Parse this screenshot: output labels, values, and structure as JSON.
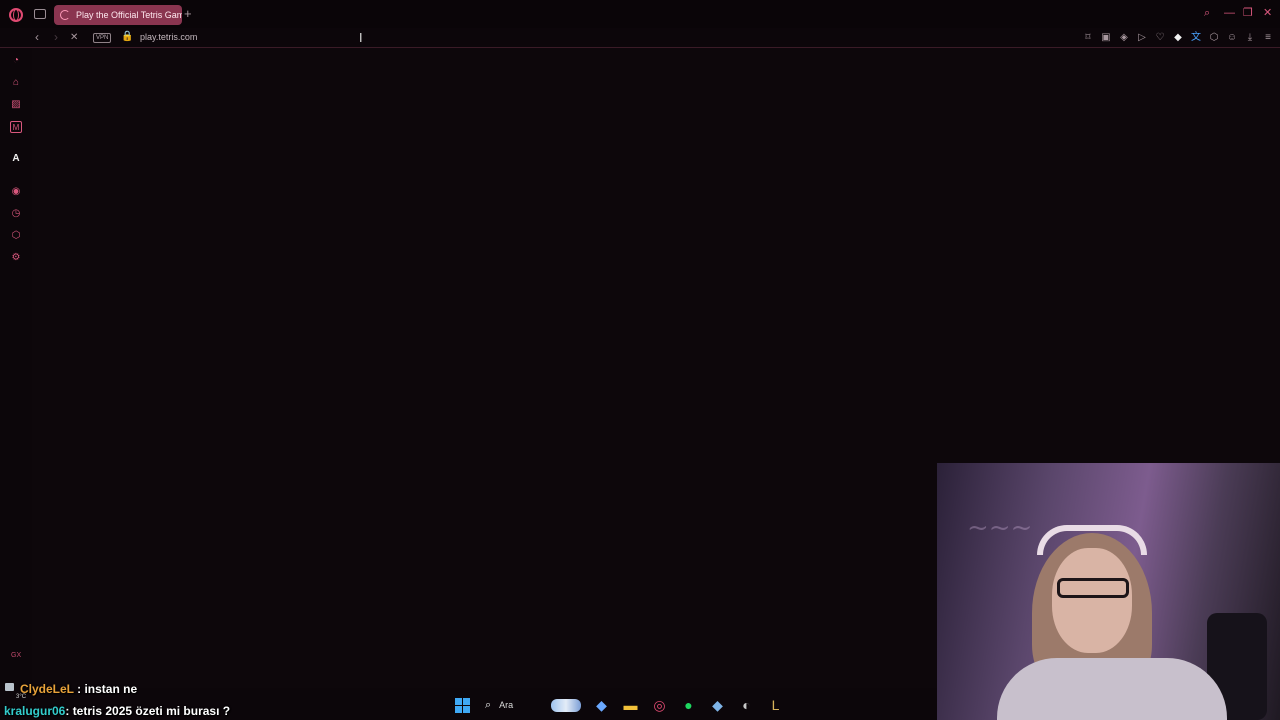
{
  "browser": {
    "tab_title": "Play the Official Tetris Game",
    "new_tab": "+",
    "url": "play.tetris.com",
    "vpn_badge": "VPN",
    "accent_color": "#e04a72"
  },
  "window_controls": {
    "search": "⌕",
    "minimize": "—",
    "maximize": "❐",
    "close": "✕"
  },
  "nav": {
    "back": "‹",
    "forward": "›",
    "stop": "✕"
  },
  "toolbar_icons": [
    "bookmark-icon",
    "snapshot-icon",
    "shield-icon",
    "play-icon",
    "heart-icon",
    "ext-diamond-icon",
    "ext-translate-icon",
    "extensions-icon",
    "account-icon",
    "download-icon",
    "menu-icon"
  ],
  "toolbar_glyphs": {
    "bookmark": "⌑",
    "snapshot": "▣",
    "shield": "◈",
    "play": "▷",
    "heart": "♡",
    "diamond": "◆",
    "translate": "文",
    "extensions": "⬡",
    "account": "☺",
    "download": "⤓",
    "menu": "≡"
  },
  "sidebar": {
    "items": [
      {
        "name": "gx-control-icon",
        "glyph": "◔"
      },
      {
        "name": "gx-corner-icon",
        "glyph": "⌂"
      },
      {
        "name": "gx-store-icon",
        "glyph": "▨"
      },
      {
        "name": "messenger-icon",
        "glyph": "M"
      },
      {
        "name": "aria-icon",
        "glyph": "A"
      },
      {
        "name": "player-icon",
        "glyph": "◉"
      },
      {
        "name": "history-icon",
        "glyph": "◷"
      },
      {
        "name": "extensions-icon",
        "glyph": "⬡"
      },
      {
        "name": "settings-icon",
        "glyph": "⚙"
      }
    ],
    "footer": "GX"
  },
  "chat": [
    {
      "user": "ClydeLeL",
      "message": " : instan ne"
    },
    {
      "user": "kralugur06",
      "message": ": tetris 2025 özeti mi burası ?"
    }
  ],
  "weather": "3°C",
  "taskbar": {
    "search_label": "Ara",
    "apps": [
      "start-icon",
      "search-icon",
      "copilot-icon",
      "file-explorer-icon",
      "opera-gx-icon",
      "spotify-icon",
      "app-icon",
      "steam-icon",
      "league-client-icon"
    ]
  }
}
